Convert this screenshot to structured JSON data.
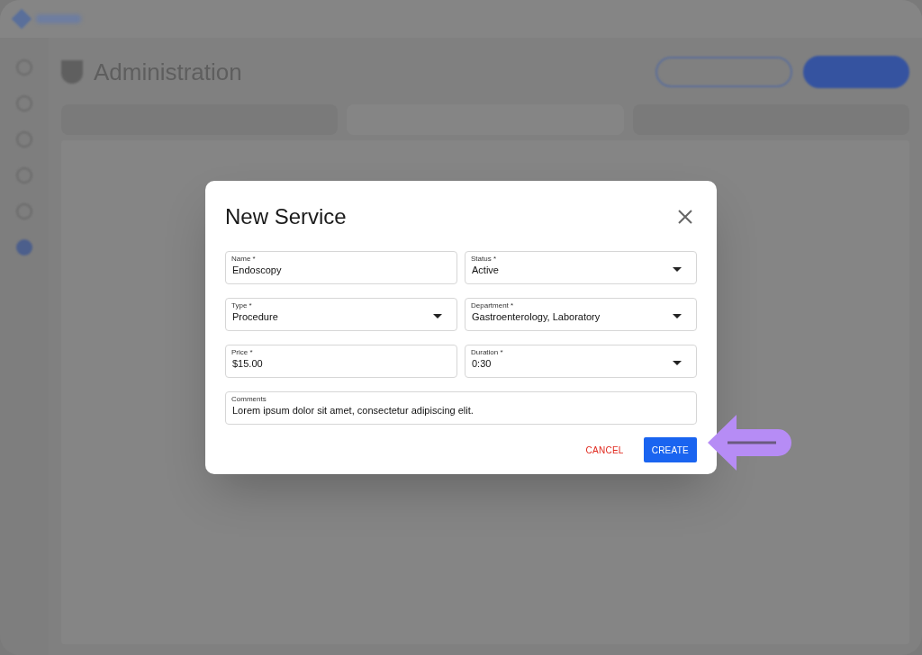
{
  "background": {
    "page_title": "Administration"
  },
  "dialog": {
    "title": "New Service",
    "fields": [
      {
        "label": "Name *",
        "value": "Endoscopy",
        "kind": "text"
      },
      {
        "label": "Status *",
        "value": "Active",
        "kind": "select"
      },
      {
        "label": "Type *",
        "value": "Procedure",
        "kind": "select"
      },
      {
        "label": "Department *",
        "value": "Gastroenterology, Laboratory",
        "kind": "select"
      },
      {
        "label": "Price *",
        "value": "$15.00",
        "kind": "text"
      },
      {
        "label": "Duration *",
        "value": "0:30",
        "kind": "select"
      },
      {
        "label": "Comments",
        "value": "Lorem ipsum dolor sit amet, consectetur adipiscing elit.",
        "kind": "wide"
      }
    ],
    "buttons": [
      {
        "label": "CANCEL",
        "kind": "text"
      },
      {
        "label": "CREATE",
        "kind": "primary"
      }
    ]
  }
}
